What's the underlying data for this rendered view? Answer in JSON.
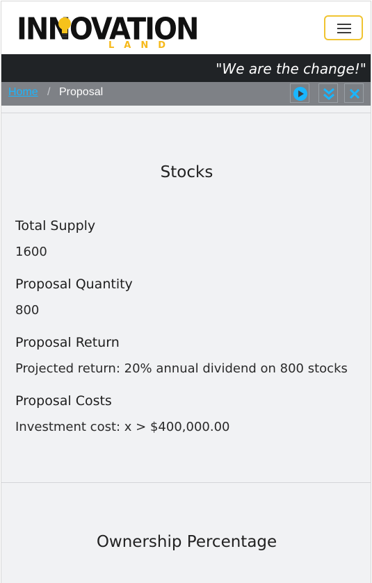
{
  "header": {
    "logo_word": "INNOVATION",
    "logo_sub": "LAND",
    "menu_toggle_icon": "hamburger-icon",
    "accent_color": "#f0c431"
  },
  "slogan": "\"We are the change!\"",
  "breadcrumb": {
    "home": "Home",
    "separator": "/",
    "current": "Proposal"
  },
  "controls": [
    {
      "icon": "play-circle-icon"
    },
    {
      "icon": "double-chevron-down-icon"
    },
    {
      "icon": "close-icon"
    }
  ],
  "stocks": {
    "title": "Stocks",
    "fields": [
      {
        "label": "Total Supply",
        "value": "1600"
      },
      {
        "label": "Proposal Quantity",
        "value": "800"
      },
      {
        "label": "Proposal Return",
        "value": "Projected return: 20% annual dividend on 800 stocks"
      },
      {
        "label": "Proposal Costs",
        "value": "Investment cost: x > $400,000.00"
      }
    ]
  },
  "ownership": {
    "title": "Ownership Percentage"
  }
}
